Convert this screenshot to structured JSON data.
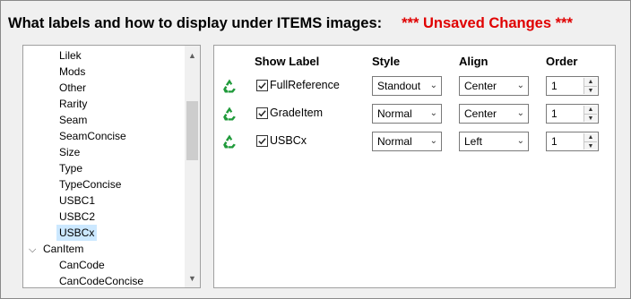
{
  "header": {
    "title": "What labels and how to display under ITEMS images:",
    "warning": "*** Unsaved Changes ***",
    "warning_color": "#e00000"
  },
  "tree": {
    "items": [
      {
        "label": "Lilek",
        "level": 2
      },
      {
        "label": "Mods",
        "level": 2
      },
      {
        "label": "Other",
        "level": 2
      },
      {
        "label": "Rarity",
        "level": 2
      },
      {
        "label": "Seam",
        "level": 2
      },
      {
        "label": "SeamConcise",
        "level": 2
      },
      {
        "label": "Size",
        "level": 2
      },
      {
        "label": "Type",
        "level": 2
      },
      {
        "label": "TypeConcise",
        "level": 2
      },
      {
        "label": "USBC1",
        "level": 2
      },
      {
        "label": "USBC2",
        "level": 2
      },
      {
        "label": "USBCx",
        "level": 2,
        "selected": true
      },
      {
        "label": "CanItem",
        "level": 1,
        "expanded": true
      },
      {
        "label": "CanCode",
        "level": 2
      },
      {
        "label": "CanCodeConcise",
        "level": 2
      }
    ]
  },
  "table": {
    "headers": {
      "show_label": "Show Label",
      "style": "Style",
      "align": "Align",
      "order": "Order"
    },
    "rows": [
      {
        "checked": true,
        "label": "FullReference",
        "style": "Standout",
        "align": "Center",
        "order": "1"
      },
      {
        "checked": true,
        "label": "GradeItem",
        "style": "Normal",
        "align": "Center",
        "order": "1"
      },
      {
        "checked": true,
        "label": "USBCx",
        "style": "Normal",
        "align": "Left",
        "order": "1"
      }
    ]
  },
  "icons": {
    "recycle": "recycle-icon",
    "recycle_color": "#1f9a3a"
  }
}
